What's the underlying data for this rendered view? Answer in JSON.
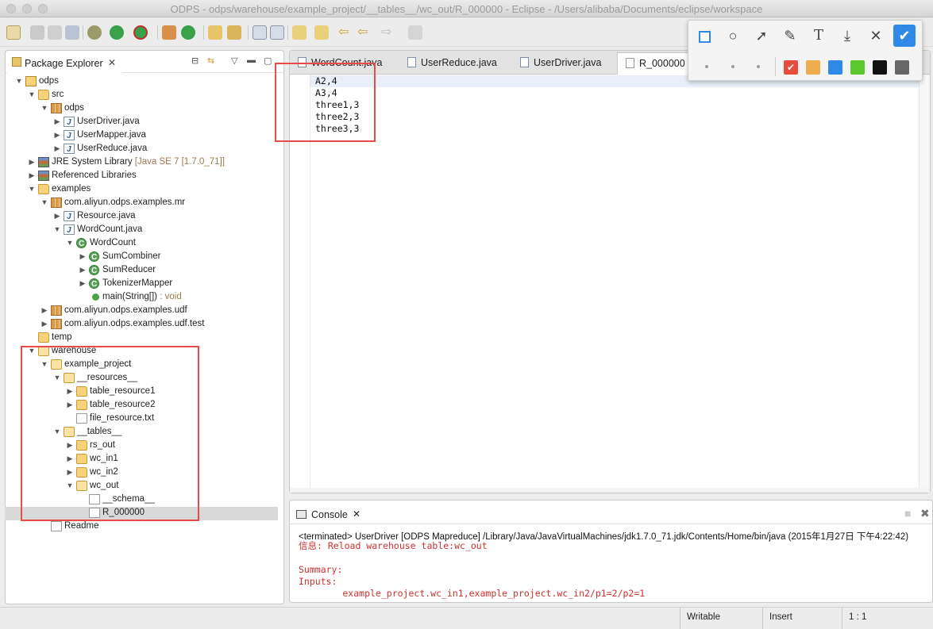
{
  "window": {
    "title": "ODPS - odps/warehouse/example_project/__tables__/wc_out/R_000000 - Eclipse - /Users/alibaba/Documents/eclipse/workspace"
  },
  "package_explorer": {
    "tab_label": "Package Explorer",
    "tree": [
      {
        "label": "odps",
        "depth": 0,
        "icon": "project-icon",
        "expanded": true
      },
      {
        "label": "src",
        "depth": 1,
        "icon": "source-folder-icon",
        "expanded": true
      },
      {
        "label": "odps",
        "depth": 2,
        "icon": "package-icon",
        "expanded": true
      },
      {
        "label": "UserDriver.java",
        "depth": 3,
        "icon": "java-file-icon",
        "expanded": false
      },
      {
        "label": "UserMapper.java",
        "depth": 3,
        "icon": "java-file-icon",
        "expanded": false
      },
      {
        "label": "UserReduce.java",
        "depth": 3,
        "icon": "java-file-icon",
        "expanded": false
      },
      {
        "label": "JRE System Library",
        "decoration": "[Java SE 7 [1.7.0_71]]",
        "depth": 1,
        "icon": "library-icon",
        "expanded": false
      },
      {
        "label": "Referenced Libraries",
        "depth": 1,
        "icon": "library-icon",
        "expanded": false
      },
      {
        "label": "examples",
        "depth": 1,
        "icon": "source-folder-icon",
        "expanded": true
      },
      {
        "label": "com.aliyun.odps.examples.mr",
        "depth": 2,
        "icon": "package-icon",
        "expanded": true
      },
      {
        "label": "Resource.java",
        "depth": 3,
        "icon": "java-file-icon",
        "expanded": false
      },
      {
        "label": "WordCount.java",
        "depth": 3,
        "icon": "java-file-icon",
        "expanded": true
      },
      {
        "label": "WordCount",
        "depth": 4,
        "icon": "class-icon",
        "expanded": true
      },
      {
        "label": "SumCombiner",
        "depth": 5,
        "icon": "class-icon",
        "expanded": false
      },
      {
        "label": "SumReducer",
        "depth": 5,
        "icon": "class-icon",
        "expanded": false
      },
      {
        "label": "TokenizerMapper",
        "depth": 5,
        "icon": "class-icon",
        "expanded": false
      },
      {
        "label": "main(String[])",
        "decoration": ": void",
        "depth": 5,
        "icon": "method-icon",
        "leaf": true
      },
      {
        "label": "com.aliyun.odps.examples.udf",
        "depth": 2,
        "icon": "package-icon",
        "expanded": false
      },
      {
        "label": "com.aliyun.odps.examples.udf.test",
        "depth": 2,
        "icon": "package-icon",
        "expanded": false
      },
      {
        "label": "temp",
        "depth": 1,
        "icon": "folder-icon",
        "leaf": true
      },
      {
        "label": "warehouse",
        "depth": 1,
        "icon": "folder-open-icon",
        "expanded": true
      },
      {
        "label": "example_project",
        "depth": 2,
        "icon": "folder-open-icon",
        "expanded": true
      },
      {
        "label": "__resources__",
        "depth": 3,
        "icon": "folder-open-icon",
        "expanded": true
      },
      {
        "label": "table_resource1",
        "depth": 4,
        "icon": "folder-icon",
        "expanded": false
      },
      {
        "label": "table_resource2",
        "depth": 4,
        "icon": "folder-icon",
        "expanded": false
      },
      {
        "label": "file_resource.txt",
        "depth": 4,
        "icon": "text-file-icon",
        "leaf": true
      },
      {
        "label": "__tables__",
        "depth": 3,
        "icon": "folder-open-icon",
        "expanded": true
      },
      {
        "label": "rs_out",
        "depth": 4,
        "icon": "folder-icon",
        "expanded": false
      },
      {
        "label": "wc_in1",
        "depth": 4,
        "icon": "folder-icon",
        "expanded": false
      },
      {
        "label": "wc_in2",
        "depth": 4,
        "icon": "folder-icon",
        "expanded": false
      },
      {
        "label": "wc_out",
        "depth": 4,
        "icon": "folder-open-icon",
        "expanded": true
      },
      {
        "label": "__schema__",
        "depth": 5,
        "icon": "text-file-icon",
        "leaf": true
      },
      {
        "label": "R_000000",
        "depth": 5,
        "icon": "text-file-icon",
        "leaf": true,
        "selected": true
      },
      {
        "label": "Readme",
        "depth": 2,
        "icon": "text-file-icon",
        "leaf": true
      }
    ]
  },
  "editor": {
    "tabs": [
      {
        "label": "WordCount.java"
      },
      {
        "label": "UserReduce.java"
      },
      {
        "label": "UserDriver.java"
      },
      {
        "label": "R_000000",
        "active": true
      }
    ],
    "lines": [
      "A2,4",
      "A3,4",
      "three1,3",
      "three2,3",
      "three3,3"
    ]
  },
  "console": {
    "tab_label": "Console",
    "status": "<terminated> UserDriver [ODPS Mapreduce] /Library/Java/JavaVirtualMachines/jdk1.7.0_71.jdk/Contents/Home/bin/java (2015年1月27日 下午4:22:42)",
    "output": "信息: Reload warehouse table:wc_out\n\nSummary:\nInputs:\n        example_project.wc_in1,example_project.wc_in2/p1=2/p2=1"
  },
  "statusbar": {
    "writable": "Writable",
    "insert": "Insert",
    "position": "1 : 1"
  },
  "snap_toolbar": {
    "tools": [
      "rectangle-icon",
      "ellipse-icon",
      "arrow-icon",
      "brush-icon",
      "text-icon",
      "download-icon",
      "close-icon",
      "confirm-icon"
    ],
    "colors": [
      "#e74c3c",
      "#f0ad4e",
      "#2e8ae6",
      "#5cc830",
      "#111111",
      "#666666"
    ],
    "selected_color": "#e74c3c"
  }
}
